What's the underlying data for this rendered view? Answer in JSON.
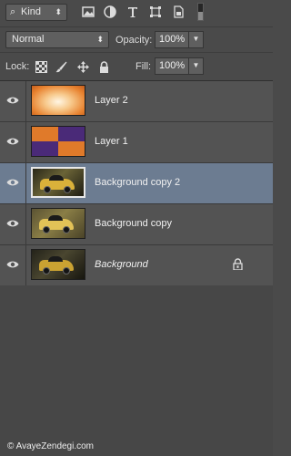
{
  "filter": {
    "kind_label": "Kind"
  },
  "blend": {
    "mode": "Normal"
  },
  "opacity": {
    "label": "Opacity:",
    "value": "100%"
  },
  "lock": {
    "label": "Lock:"
  },
  "fill": {
    "label": "Fill:",
    "value": "100%"
  },
  "layers": [
    {
      "name": "Layer 2",
      "visible": true,
      "selected": false,
      "italic": false,
      "locked": false
    },
    {
      "name": "Layer 1",
      "visible": true,
      "selected": false,
      "italic": false,
      "locked": false
    },
    {
      "name": "Background copy 2",
      "visible": true,
      "selected": true,
      "italic": false,
      "locked": false
    },
    {
      "name": "Background copy",
      "visible": true,
      "selected": false,
      "italic": false,
      "locked": false
    },
    {
      "name": "Background",
      "visible": true,
      "selected": false,
      "italic": true,
      "locked": true
    }
  ],
  "watermark": "© AvayeZendegi.com",
  "colors": {
    "panel": "#535353",
    "selected": "#6c7c91",
    "background": "#4a4a4a"
  }
}
